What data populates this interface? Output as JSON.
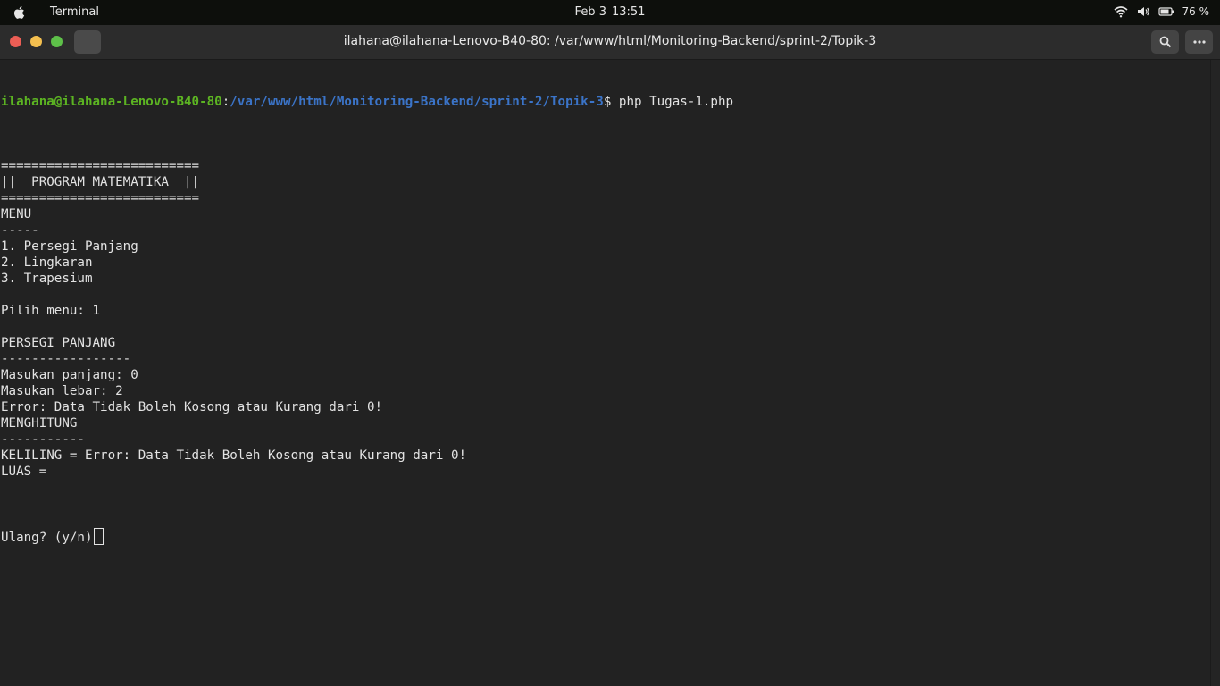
{
  "topbar": {
    "app_name": "Terminal",
    "date": "Feb 3",
    "time": "13:51",
    "battery": "76 %"
  },
  "window": {
    "title": "ilahana@ilahana-Lenovo-B40-80: /var/www/html/Monitoring-Backend/sprint-2/Topik-3"
  },
  "terminal": {
    "prompt_user": "ilahana@ilahana-Lenovo-B40-80",
    "prompt_sep": ":",
    "prompt_path": "/var/www/html/Monitoring-Backend/sprint-2/Topik-3",
    "prompt_symbol": "$ ",
    "command": "php Tugas-1.php",
    "output": [
      "",
      "==========================",
      "||  PROGRAM MATEMATIKA  ||",
      "==========================",
      "MENU",
      "-----",
      "1. Persegi Panjang",
      "2. Lingkaran",
      "3. Trapesium",
      "",
      "Pilih menu: 1",
      "",
      "PERSEGI PANJANG",
      "-----------------",
      "Masukan panjang: 0",
      "Masukan lebar: 2",
      "Error: Data Tidak Boleh Kosong atau Kurang dari 0!",
      "MENGHITUNG",
      "-----------",
      "KELILING = Error: Data Tidak Boleh Kosong atau Kurang dari 0!",
      "LUAS =",
      ""
    ],
    "input_prompt": "Ulang? (y/n)"
  },
  "icons": {
    "apple": "apple-logo-icon",
    "wifi": "wifi-icon",
    "volume": "volume-icon",
    "battery": "battery-icon",
    "search": "search-icon",
    "menu": "more-menu-icon"
  }
}
